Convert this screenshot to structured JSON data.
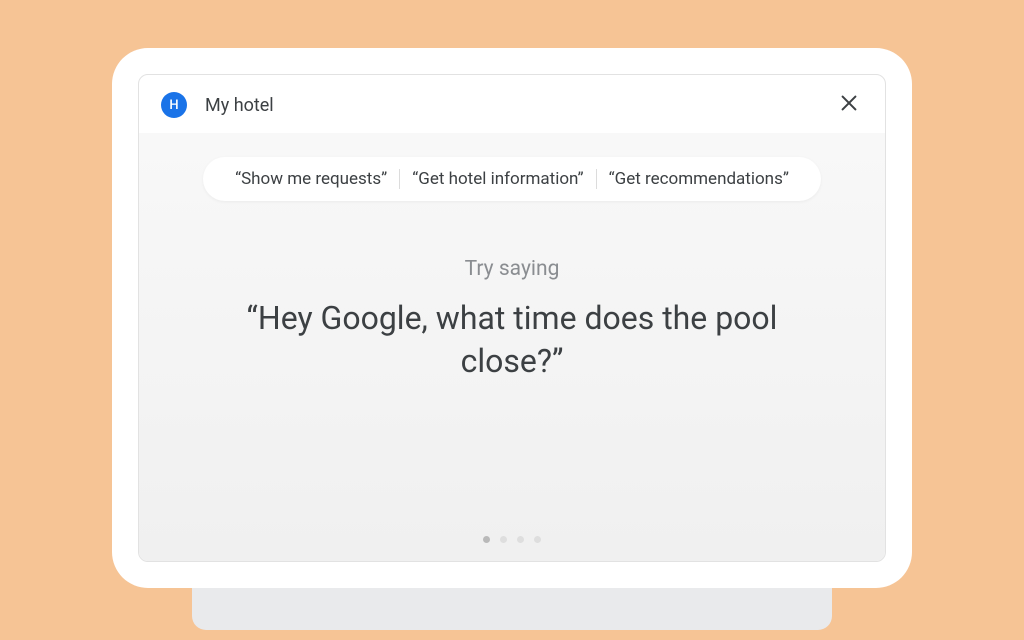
{
  "header": {
    "avatar_letter": "H",
    "title": "My hotel"
  },
  "chips": [
    "“Show me requests”",
    "“Get hotel information”",
    "“Get recommendations”"
  ],
  "prompt": {
    "label": "Try saying",
    "phrase": "“Hey Google, what time does the pool close?”"
  },
  "pager": {
    "count": 4,
    "active_index": 0
  }
}
